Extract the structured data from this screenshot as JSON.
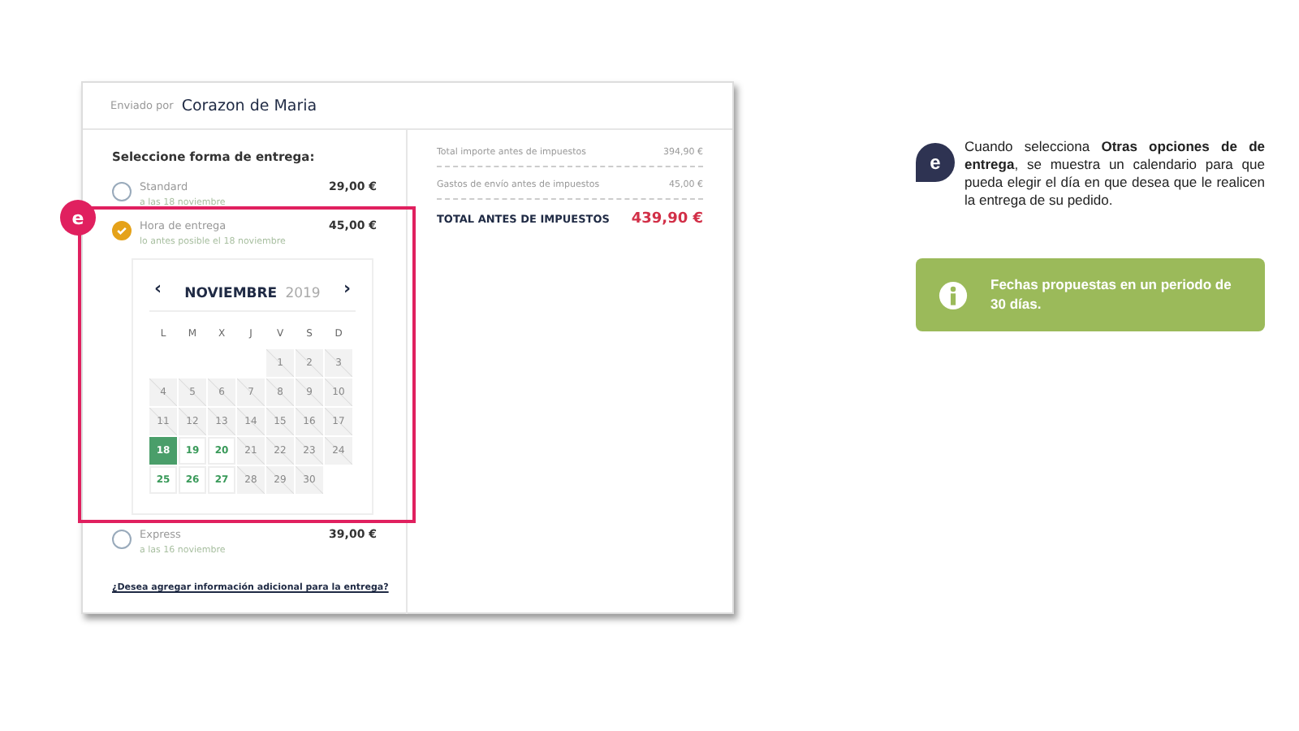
{
  "header": {
    "label": "Enviado por",
    "seller": "Corazon de Maria"
  },
  "delivery": {
    "title": "Seleccione forma de entrega:",
    "options": [
      {
        "name": "Standard",
        "note": "a las 18 noviembre",
        "price": "29,00 €",
        "selected": false
      },
      {
        "name": "Hora de entrega",
        "note": "lo antes posible el 18 noviembre",
        "price": "45,00 €",
        "selected": true
      },
      {
        "name": "Express",
        "note": "a las 16 noviembre",
        "price": "39,00 €",
        "selected": false
      }
    ],
    "link": "¿Desea agregar información adicional para la entrega?"
  },
  "callout_badge": "e",
  "calendar": {
    "prev": "‹",
    "next": "›",
    "month": "NOVIEMBRE",
    "year": "2019",
    "weekdays": [
      "L",
      "M",
      "X",
      "J",
      "V",
      "S",
      "D"
    ],
    "weeks": [
      [
        {
          "day": "1",
          "kind": "disabled"
        },
        {
          "day": "2",
          "kind": "disabled"
        },
        {
          "day": "3",
          "kind": "disabled"
        }
      ],
      [
        {
          "day": "4",
          "kind": "disabled"
        },
        {
          "day": "5",
          "kind": "disabled"
        },
        {
          "day": "6",
          "kind": "disabled"
        },
        {
          "day": "7",
          "kind": "disabled"
        },
        {
          "day": "8",
          "kind": "disabled"
        },
        {
          "day": "9",
          "kind": "disabled"
        },
        {
          "day": "10",
          "kind": "disabled"
        }
      ],
      [
        {
          "day": "11",
          "kind": "disabled"
        },
        {
          "day": "12",
          "kind": "disabled"
        },
        {
          "day": "13",
          "kind": "disabled"
        },
        {
          "day": "14",
          "kind": "disabled"
        },
        {
          "day": "15",
          "kind": "disabled"
        },
        {
          "day": "16",
          "kind": "disabled"
        },
        {
          "day": "17",
          "kind": "disabled"
        }
      ],
      [
        {
          "day": "18",
          "kind": "selected"
        },
        {
          "day": "19",
          "kind": "available"
        },
        {
          "day": "20",
          "kind": "available"
        },
        {
          "day": "21",
          "kind": "disabled"
        },
        {
          "day": "22",
          "kind": "disabled"
        },
        {
          "day": "23",
          "kind": "disabled"
        },
        {
          "day": "24",
          "kind": "disabled"
        }
      ],
      [
        {
          "day": "25",
          "kind": "available"
        },
        {
          "day": "26",
          "kind": "available"
        },
        {
          "day": "27",
          "kind": "available"
        },
        {
          "day": "28",
          "kind": "disabled"
        },
        {
          "day": "29",
          "kind": "disabled"
        },
        {
          "day": "30",
          "kind": "disabled"
        }
      ]
    ]
  },
  "summary": {
    "lines": [
      {
        "label": "Total importe antes de impuestos",
        "value": "394,90 €"
      },
      {
        "label": "Gastos de envío antes de impuestos",
        "value": "45,00 €"
      }
    ],
    "total_label": "TOTAL ANTES DE IMPUESTOS",
    "total_value": "439,90 €"
  },
  "annotation": {
    "badge": "e",
    "text": "Cuando selecciona **Otras opciones de de entrega**, se muestra un calendario para que pueda elegir el día en que desea que le realicen la entrega de su pedido.",
    "info": "Fechas propuestas  en un periodo de 30 días."
  }
}
